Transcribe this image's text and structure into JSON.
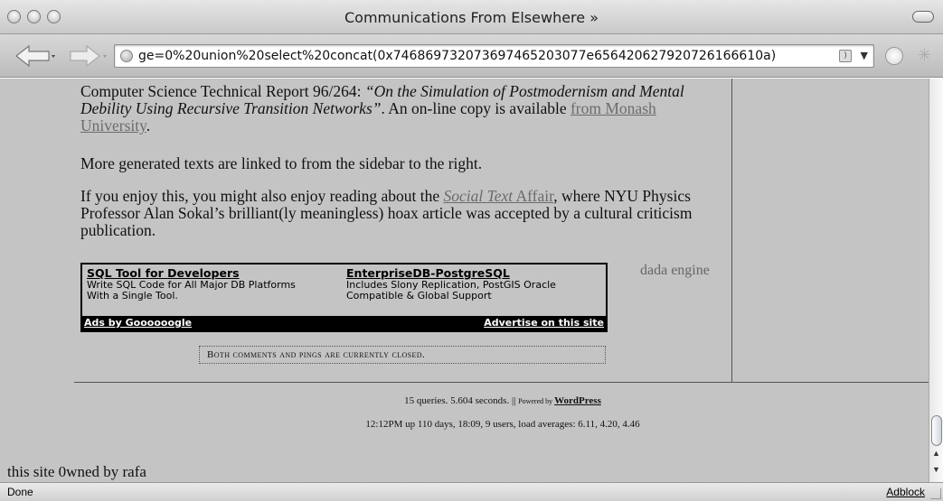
{
  "window": {
    "title": "Communications From Elsewhere »"
  },
  "toolbar": {
    "url": "ge=0%20union%20select%20concat(0x746869732073697465203077e656420627920726166610a)"
  },
  "icons": [
    "back-arrow-icon",
    "forward-arrow-icon",
    "globe-icon",
    "rss-icon",
    "dropdown-icon",
    "stop-icon",
    "spinner-icon"
  ],
  "article": {
    "p1_prefix": "Computer Science Technical Report 96/264: ",
    "p1_title": "“On the Simulation of Postmodernism and Mental Debility Using Recursive Transition Networks”",
    "p1_suffix": ". An on-line copy is available ",
    "p1_link": "from Monash University",
    "p1_end": ".",
    "p2": "More generated texts are linked to from the sidebar to the right.",
    "p3_prefix": "If you enjoy this, you might also enjoy reading about the ",
    "p3_link_italic": "Social Text",
    "p3_link_rest": " Affair",
    "p3_suffix": ", where NYU Physics Professor Alan Sokal’s brilliant(ly meaningless) hoax article was accepted by a cultural criticism publication."
  },
  "sidebar": {
    "dada": "dada engine"
  },
  "ads": {
    "ad1_title": "SQL Tool for Developers",
    "ad1_line1": "Write SQL Code for All Major DB Platforms",
    "ad1_line2": "With a Single Tool.",
    "ad2_title": "EnterpriseDB-PostgreSQL",
    "ad2_line1": "Includes Slony Replication, PostGIS Oracle",
    "ad2_line2": "Compatible & Global Support",
    "footer_left": "Ads by Goooooogle",
    "footer_right": "Advertise on this site"
  },
  "comments": {
    "closed": "Both comments and pings are currently closed."
  },
  "footer": {
    "queries": "15 queries. 5.604 seconds. || ",
    "powered": "Powered by ",
    "wordpress": "WordPress",
    "uptime": "12:12PM up 110 days, 18:09, 9 users, load averages: 6.11, 4.20, 4.46"
  },
  "injected": {
    "owned": "this site 0wned by rafa"
  },
  "statusbar": {
    "left": "Done",
    "right": "Adblock"
  }
}
